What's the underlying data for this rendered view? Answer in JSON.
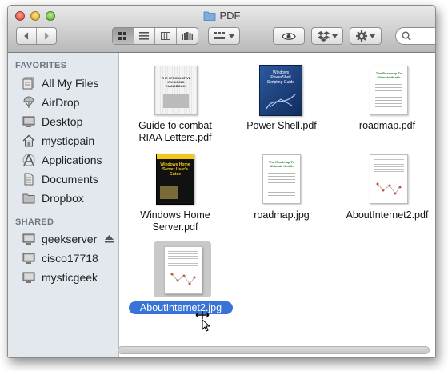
{
  "window": {
    "title": "PDF"
  },
  "toolbar": {
    "back_icon": "chevron-left-icon",
    "forward_icon": "chevron-right-icon",
    "view_modes": [
      "icon-view",
      "list-view",
      "column-view",
      "cover-flow-view"
    ],
    "arrange_icon": "arrange-icon",
    "quicklook_icon": "eye-icon",
    "dropbox_icon": "dropbox-icon",
    "action_icon": "gear-icon",
    "search_placeholder": ""
  },
  "sidebar": {
    "favorites_header": "FAVORITES",
    "favorites": [
      {
        "label": "All My Files",
        "icon": "all-files-icon"
      },
      {
        "label": "AirDrop",
        "icon": "airdrop-icon"
      },
      {
        "label": "Desktop",
        "icon": "desktop-icon"
      },
      {
        "label": "mysticpain",
        "icon": "home-icon"
      },
      {
        "label": "Applications",
        "icon": "applications-icon"
      },
      {
        "label": "Documents",
        "icon": "documents-icon"
      },
      {
        "label": "Dropbox",
        "icon": "folder-icon"
      }
    ],
    "shared_header": "SHARED",
    "shared": [
      {
        "label": "geekserver",
        "icon": "computer-icon",
        "eject": true
      },
      {
        "label": "cisco17718",
        "icon": "computer-icon"
      },
      {
        "label": "mysticgeek",
        "icon": "computer-icon"
      }
    ]
  },
  "files": [
    {
      "line1": "Guide to combat",
      "line2": "RIAA Letters.pdf",
      "thumb_title": "THE SPECULATIVE INVOICING HANDBOOK"
    },
    {
      "line1": "Power Shell.pdf",
      "line2": "",
      "thumb_title": "Windows PowerShell Scripting Guide"
    },
    {
      "line1": "roadmap.pdf",
      "line2": "",
      "thumb_title": "The Roadmap To Ultimate Health"
    },
    {
      "line1": "Windows Home",
      "line2": "Server.pdf",
      "thumb_title": "Windows Home Server User's Guide"
    },
    {
      "line1": "roadmap.jpg",
      "line2": "",
      "thumb_title": "The Roadmap To Ultimate Health"
    },
    {
      "line1": "AboutInternet2.pdf",
      "line2": "",
      "thumb_title": ""
    },
    {
      "line1": "AboutInternet2.jpg",
      "line2": "",
      "thumb_title": "",
      "selected": true
    }
  ],
  "colors": {
    "selection": "#3874d8",
    "sidebar_bg": "#e3e8ee"
  }
}
